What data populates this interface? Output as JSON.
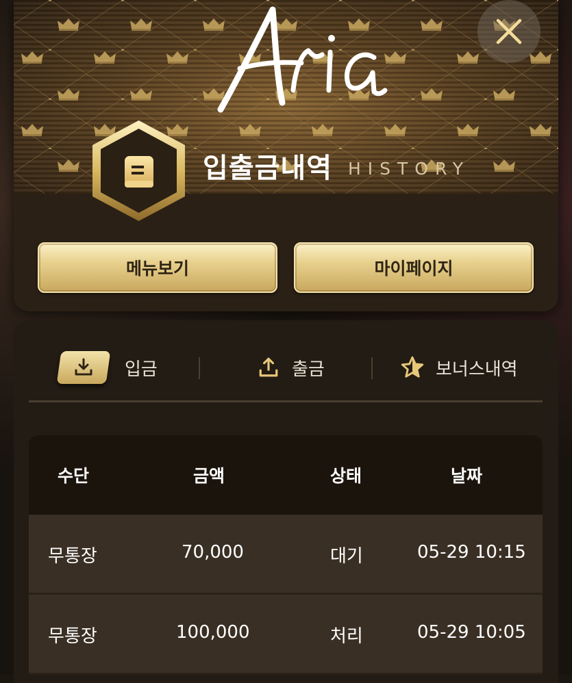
{
  "header": {
    "logo_text": "Aria",
    "title_ko": "입출금내역",
    "title_en": "HISTORY",
    "close_icon": "close-icon",
    "badge_icon": "book-icon"
  },
  "buttons": {
    "menu": "메뉴보기",
    "mypage": "마이페이지"
  },
  "tabs": [
    {
      "label": "입금",
      "icon": "download-icon",
      "active": true
    },
    {
      "label": "출금",
      "icon": "upload-icon",
      "active": false
    },
    {
      "label": "보너스내역",
      "icon": "star-icon",
      "active": false
    }
  ],
  "table": {
    "headers": [
      "수단",
      "금액",
      "상태",
      "날짜"
    ],
    "rows": [
      [
        "무통장",
        "70,000",
        "대기",
        "05-29 10:15"
      ],
      [
        "무통장",
        "100,000",
        "처리",
        "05-29 10:05"
      ]
    ]
  },
  "colors": {
    "gold": "#e7d08c",
    "background": "#231c14",
    "text": "#ffffff"
  }
}
